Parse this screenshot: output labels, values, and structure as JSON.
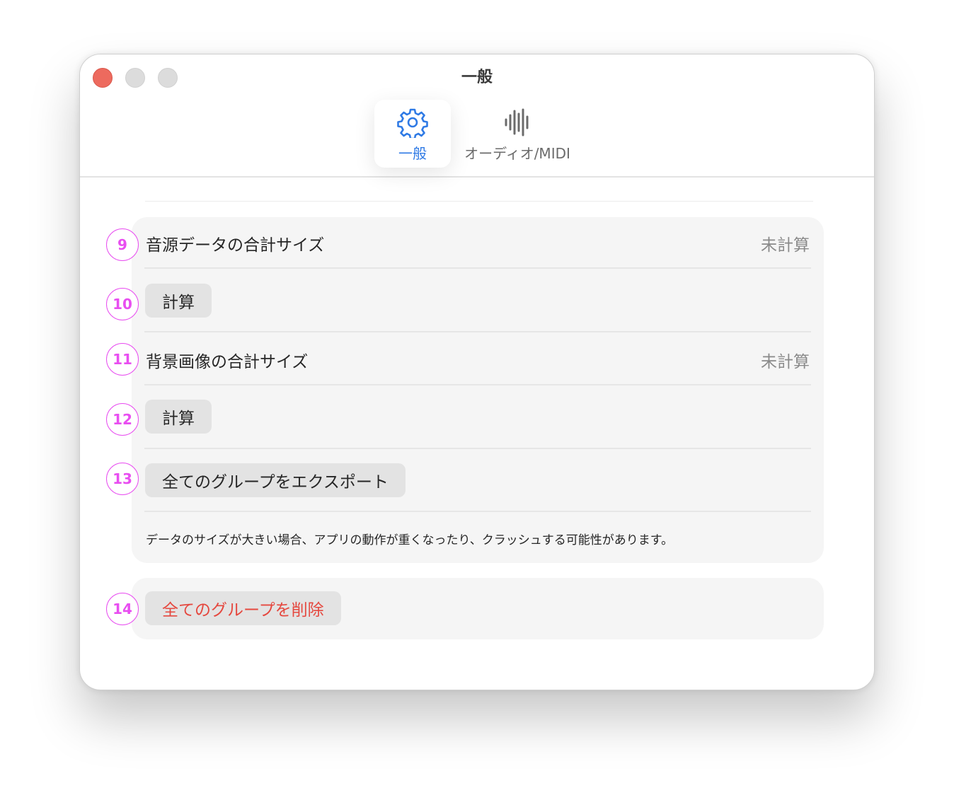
{
  "window": {
    "title": "一般"
  },
  "tabs": [
    {
      "label": "一般",
      "icon": "gear-icon",
      "selected": true
    },
    {
      "label": "オーディオ/MIDI",
      "icon": "waveform-icon",
      "selected": false
    }
  ],
  "storage": {
    "audio_size_label": "音源データの合計サイズ",
    "audio_size_value": "未計算",
    "audio_calc_button": "計算",
    "image_size_label": "背景画像の合計サイズ",
    "image_size_value": "未計算",
    "image_calc_button": "計算",
    "export_button": "全てのグループをエクスポート",
    "note": "データのサイズが大きい場合、アプリの動作が重くなったり、クラッシュする可能性があります。"
  },
  "danger": {
    "delete_button": "全てのグループを削除"
  },
  "badges": [
    "9",
    "10",
    "11",
    "12",
    "13",
    "14"
  ],
  "colors": {
    "accent": "#2f7ae5",
    "danger": "#e5483f",
    "badge": "#e84ef0",
    "close": "#ed6a5e"
  }
}
